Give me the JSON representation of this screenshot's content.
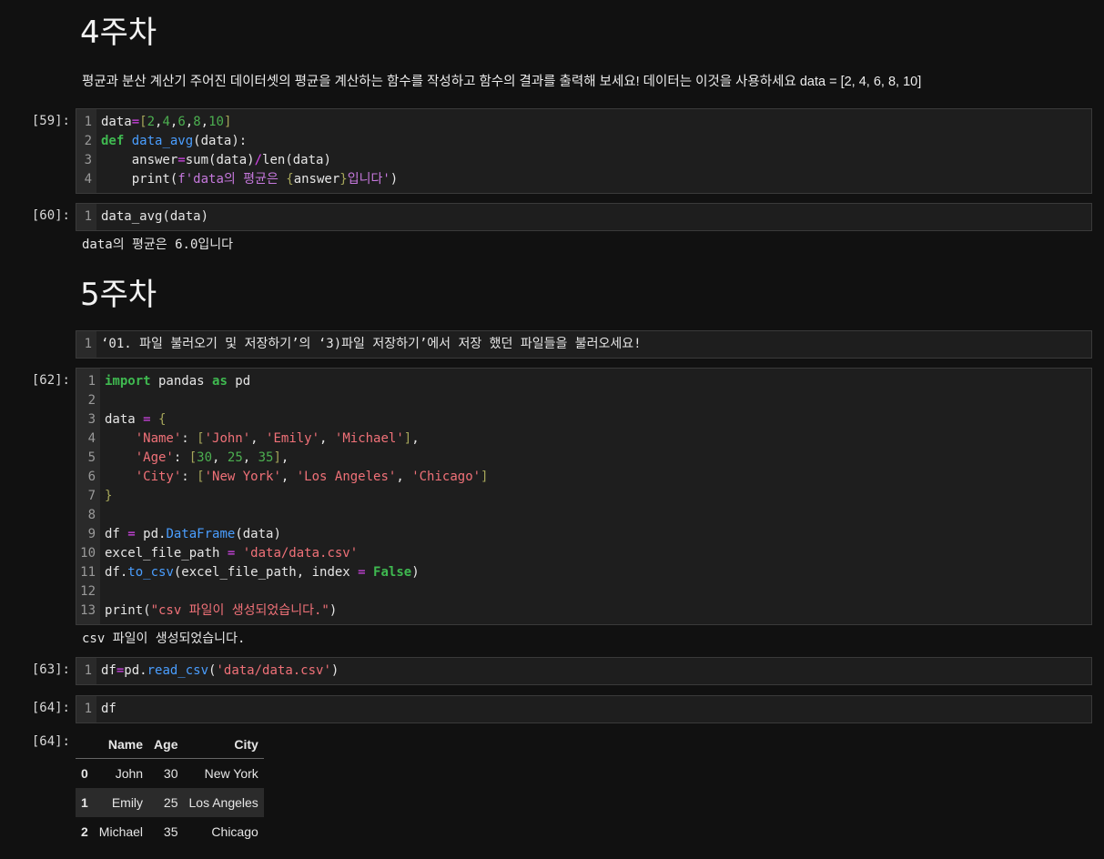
{
  "headings": {
    "week4": "4주차",
    "week5": "5주차"
  },
  "week4_description": "평균과 분산 계산기 주어진 데이터셋의 평균을 계산하는 함수를 작성하고 함수의 결과를 출력해 보세요! 데이터는 이것을 사용하세요 data = [2, 4, 6, 8, 10]",
  "cells": {
    "c59": {
      "prompt": "[59]:",
      "lines": [
        {
          "n": "1",
          "t": "data=[2,4,6,8,10]"
        },
        {
          "n": "2",
          "t": "def data_avg(data):"
        },
        {
          "n": "3",
          "t": "    answer=sum(data)/len(data)"
        },
        {
          "n": "4",
          "t": "    print(f'data의 평균은 {answer}입니다')"
        }
      ]
    },
    "c60": {
      "prompt": "[60]:",
      "lines": [
        {
          "n": "1",
          "t": "data_avg(data)"
        }
      ],
      "output": "data의 평균은 6.0입니다"
    },
    "cmd": {
      "lines": [
        {
          "n": "1",
          "t": "‘01. 파일 불러오기 및 저장하기’의 ‘3)파일 저장하기’에서 저장 했던 파일들을 불러오세요!"
        }
      ]
    },
    "c62": {
      "prompt": "[62]:",
      "lines": [
        {
          "n": "1",
          "t": "import pandas as pd"
        },
        {
          "n": "2",
          "t": ""
        },
        {
          "n": "3",
          "t": "data = {"
        },
        {
          "n": "4",
          "t": "    'Name': ['John', 'Emily', 'Michael'],"
        },
        {
          "n": "5",
          "t": "    'Age': [30, 25, 35],"
        },
        {
          "n": "6",
          "t": "    'City': ['New York', 'Los Angeles', 'Chicago']"
        },
        {
          "n": "7",
          "t": "}"
        },
        {
          "n": "8",
          "t": ""
        },
        {
          "n": "9",
          "t": "df = pd.DataFrame(data)"
        },
        {
          "n": "10",
          "t": "excel_file_path = 'data/data.csv'"
        },
        {
          "n": "11",
          "t": "df.to_csv(excel_file_path, index = False)"
        },
        {
          "n": "12",
          "t": ""
        },
        {
          "n": "13",
          "t": "print(\"csv 파일이 생성되었습니다.\")"
        }
      ],
      "output": "csv 파일이 생성되었습니다."
    },
    "c63": {
      "prompt": "[63]:",
      "lines": [
        {
          "n": "1",
          "t": "df=pd.read_csv('data/data.csv')"
        }
      ]
    },
    "c64": {
      "prompt": "[64]:",
      "lines": [
        {
          "n": "1",
          "t": "df"
        }
      ],
      "output_prompt": "[64]:"
    }
  },
  "dataframe": {
    "columns": [
      "",
      "Name",
      "Age",
      "City"
    ],
    "rows": [
      {
        "index": "0",
        "Name": "John",
        "Age": "30",
        "City": "New York"
      },
      {
        "index": "1",
        "Name": "Emily",
        "Age": "25",
        "City": "Los Angeles"
      },
      {
        "index": "2",
        "Name": "Michael",
        "Age": "35",
        "City": "Chicago"
      }
    ]
  }
}
